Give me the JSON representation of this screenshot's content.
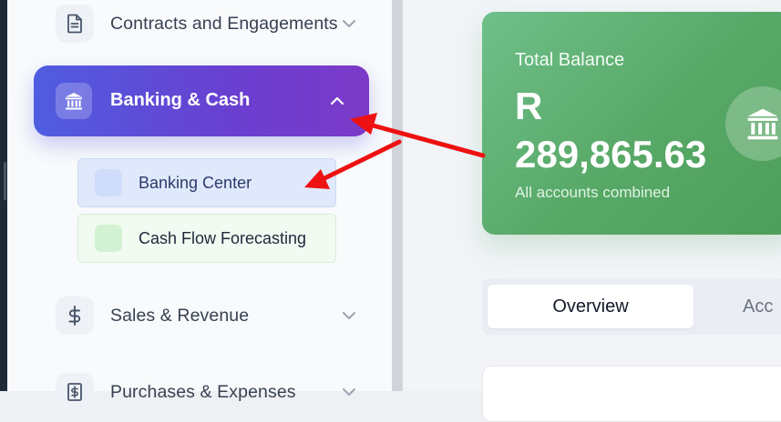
{
  "sidebar": {
    "items": [
      {
        "label": "Contracts and Engagements",
        "icon": "document-icon"
      },
      {
        "label": "Banking & Cash",
        "icon": "bank-icon",
        "active": true,
        "children": [
          {
            "label": "Banking Center"
          },
          {
            "label": "Cash Flow Forecasting"
          }
        ]
      },
      {
        "label": "Sales & Revenue",
        "icon": "dollar-icon"
      },
      {
        "label": "Purchases & Expenses",
        "icon": "receipt-icon"
      }
    ]
  },
  "balance": {
    "label": "Total Balance",
    "currency": "R",
    "amount": "289,865.63",
    "subtitle": "All accounts combined",
    "icon": "bank-icon"
  },
  "tabs": [
    {
      "label": "Overview",
      "active": true
    },
    {
      "label": "Acc"
    }
  ],
  "colors": {
    "active_gradient_start": "#4f5de0",
    "active_gradient_end": "#7c3ac8",
    "balance_card": "#57a866",
    "annotation_arrow": "#ee1111"
  }
}
